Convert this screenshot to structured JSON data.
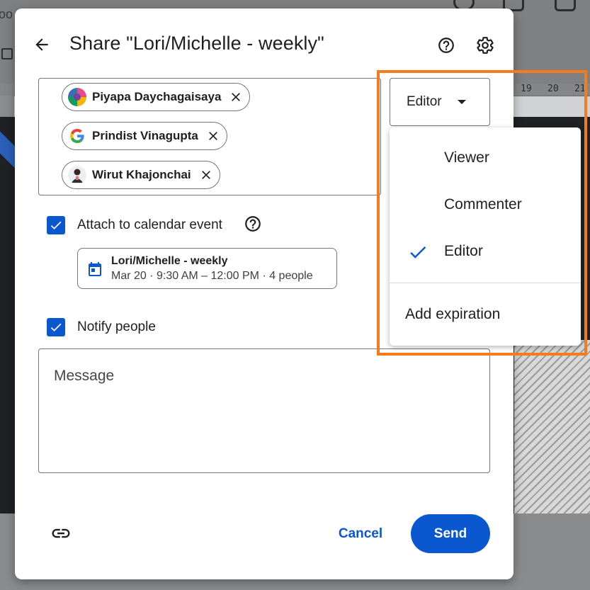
{
  "background": {
    "tab_text": "oo",
    "ruler_numbers": [
      "19",
      "20",
      "21"
    ]
  },
  "dialog": {
    "title": "Share \"Lori/Michelle - weekly\"",
    "icons": {
      "back": "arrow-left-icon",
      "help": "help-circle-icon",
      "settings": "gear-icon"
    }
  },
  "recipients": [
    {
      "name": "Piyapa Daychagaisaya",
      "avatar": "colorful-avatar"
    },
    {
      "name": "Prindist Vinagupta",
      "avatar": "google-g-logo"
    },
    {
      "name": "Wirut Khajonchai",
      "avatar": "person-avatar"
    }
  ],
  "role_select": {
    "selected": "Editor"
  },
  "calendar": {
    "label": "Attach to calendar event",
    "checked": true,
    "event": {
      "title": "Lori/Michelle - weekly",
      "details": "Mar 20 · 9:30 AM – 12:00 PM · 4 people"
    }
  },
  "notify": {
    "label": "Notify people",
    "checked": true
  },
  "message": {
    "placeholder": "Message"
  },
  "footer": {
    "cancel": "Cancel",
    "send": "Send"
  },
  "role_menu": {
    "items": [
      {
        "label": "Viewer",
        "selected": false
      },
      {
        "label": "Commenter",
        "selected": false
      },
      {
        "label": "Editor",
        "selected": true
      }
    ],
    "add_expiration": "Add expiration"
  },
  "colors": {
    "primary": "#0b57d0",
    "highlight": "#f47c20",
    "text": "#1f1f1f",
    "outline": "#747775"
  }
}
